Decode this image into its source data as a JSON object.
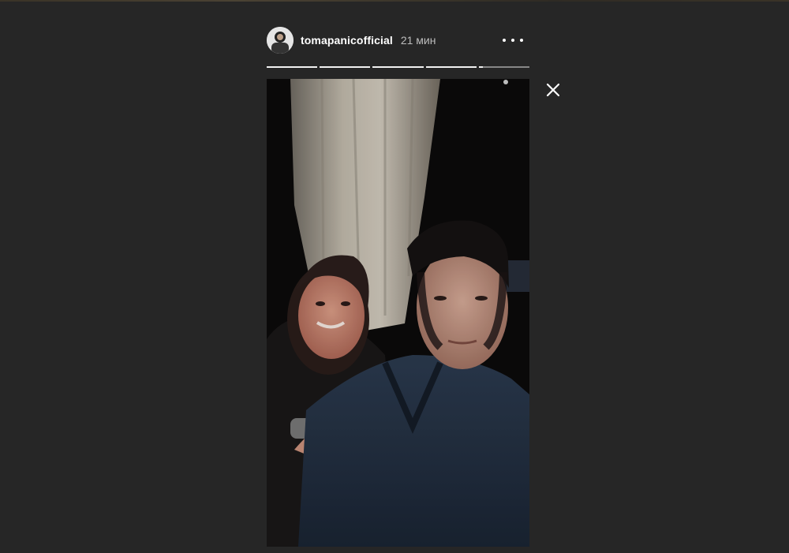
{
  "story": {
    "username": "tomapanicofficial",
    "time": "21 мин",
    "segments": [
      {
        "progress": 1
      },
      {
        "progress": 1
      },
      {
        "progress": 1
      },
      {
        "progress": 1
      },
      {
        "progress": 0.08
      }
    ],
    "photo": {
      "subjects": [
        "woman",
        "man"
      ]
    }
  },
  "icons": {
    "avatar": "avatar-icon",
    "more": "more-options-icon",
    "close": "close-icon"
  },
  "colors": {
    "background": "#262626",
    "text": "#ffffff",
    "muted_text": "#bdbdbd"
  }
}
